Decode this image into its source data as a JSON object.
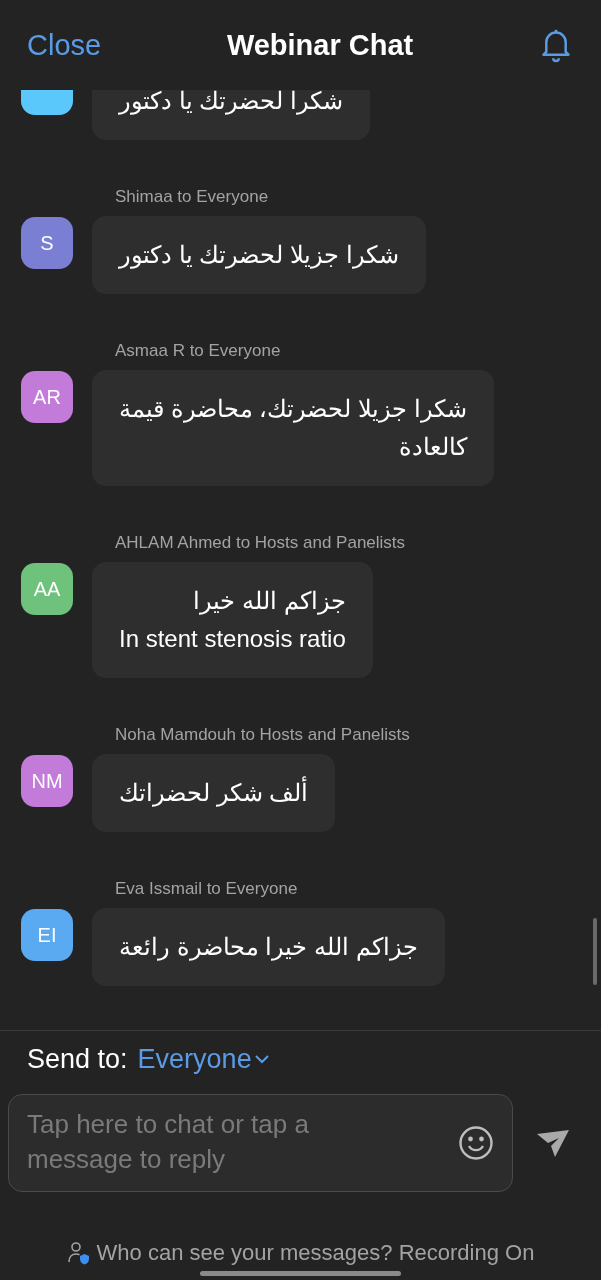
{
  "header": {
    "close": "Close",
    "title": "Webinar Chat"
  },
  "messages": [
    {
      "color": "#5ac8fa",
      "text": "شكرا لحضرتك يا دكتور",
      "cut": true
    },
    {
      "sender": "Shimaa to Everyone",
      "initials": "S",
      "color": "#7b7fd4",
      "text": "شكرا جزيلا لحضرتك يا دكتور",
      "cut": false
    },
    {
      "sender": "Asmaa R to Everyone",
      "initials": "AR",
      "color": "#c27bd8",
      "text": "شكرا جزيلا لحضرتك، محاضرة قيمة\nكالعادة",
      "cut": false
    },
    {
      "sender": "AHLAM Ahmed to Hosts and Panelists",
      "initials": "AA",
      "color": "#6fc27c",
      "text": "جزاكم الله خيرا\nIn stent stenosis ratio",
      "cut": false
    },
    {
      "sender": "Noha Mamdouh to Hosts and Panelists",
      "initials": "NM",
      "color": "#c27bd8",
      "text": "ألف شكر لحضراتك",
      "cut": false
    },
    {
      "sender": "Eva Issmail to Everyone",
      "initials": "EI",
      "color": "#5aaaf2",
      "text": "جزاكم الله خيرا محاضرة رائعة",
      "cut": false
    }
  ],
  "send_to": {
    "label": "Send to:",
    "value": "Everyone"
  },
  "input": {
    "placeholder": "Tap here to chat or tap a message to reply"
  },
  "footer": {
    "text": "Who can see your messages? Recording On"
  }
}
